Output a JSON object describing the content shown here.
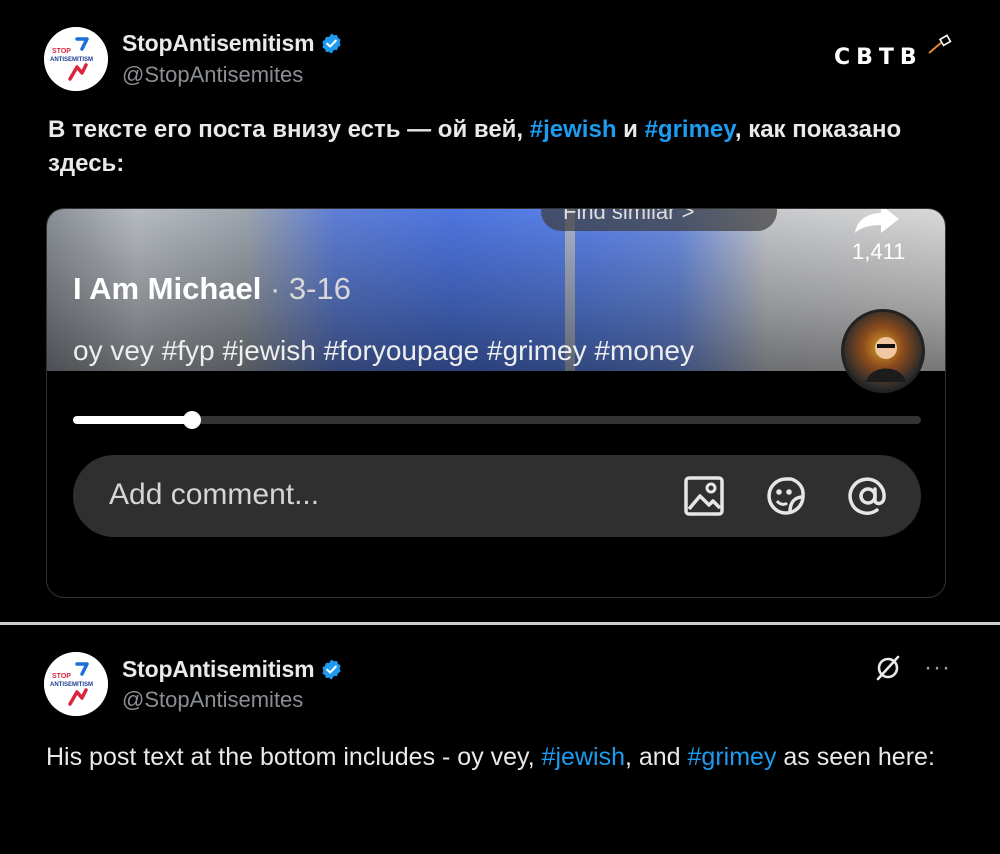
{
  "top_post": {
    "author": {
      "display_name": "StopAntisemitism",
      "handle": "@StopAntisemites",
      "avatar_text_line1": "STOP",
      "avatar_text_line2": "ANTISEMITISM"
    },
    "brand": "CBTB",
    "text": {
      "part1": "В тексте его поста внизу есть — ой вей, ",
      "tag1": "#jewish",
      "part2": " и ",
      "tag2": "#grimey",
      "part3": ", как показано здесь:"
    },
    "embedded_screenshot": {
      "find_similar_label": "Find similar >",
      "share_count": "1,411",
      "video_author": "I Am Michael",
      "video_date": " · 3-16",
      "caption": "oy vey #fyp #jewish #foryoupage #grimey #money",
      "progress": 0.14,
      "comment_placeholder": "Add comment...",
      "icons": [
        "image-icon",
        "sticker-emoji-icon",
        "mention-at-icon"
      ]
    }
  },
  "bottom_post": {
    "author": {
      "display_name": "StopAntisemitism",
      "handle": "@StopAntisemites",
      "avatar_text_line1": "STOP",
      "avatar_text_line2": "ANTISEMITISM"
    },
    "text": {
      "part1": "His post text at the bottom includes - oy vey, ",
      "tag1": "#jewish",
      "part2": ", and ",
      "tag2": "#grimey",
      "part3": " as seen here:"
    },
    "more_label": "···"
  },
  "colors": {
    "background": "#000000",
    "hashtag": "#1d9bf0",
    "verified": "#1d9bf0",
    "handle": "#8b8f94"
  }
}
